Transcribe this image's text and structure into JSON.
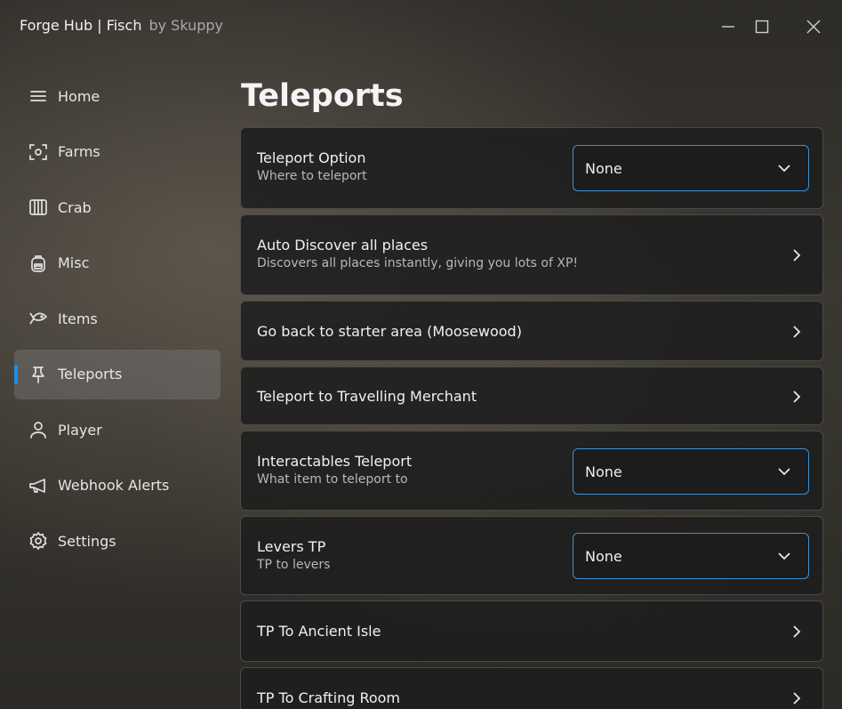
{
  "window": {
    "title": "Forge Hub | Fisch",
    "author": "by Skuppy"
  },
  "sidebar": {
    "items": [
      {
        "label": "Home",
        "icon": "menu-icon"
      },
      {
        "label": "Farms",
        "icon": "scan-icon"
      },
      {
        "label": "Crab",
        "icon": "cage-icon"
      },
      {
        "label": "Misc",
        "icon": "backpack-icon"
      },
      {
        "label": "Items",
        "icon": "fish-icon"
      },
      {
        "label": "Teleports",
        "icon": "pin-icon",
        "active": true
      },
      {
        "label": "Player",
        "icon": "user-icon"
      },
      {
        "label": "Webhook Alerts",
        "icon": "megaphone-icon"
      },
      {
        "label": "Settings",
        "icon": "gear-icon"
      }
    ]
  },
  "main": {
    "title": "Teleports",
    "cards": [
      {
        "title": "Teleport Option",
        "desc": "Where to teleport",
        "dropdown": "None"
      },
      {
        "title": "Auto Discover all places",
        "desc": "Discovers all places instantly, giving you lots of XP!"
      },
      {
        "title": "Go back to starter area (Moosewood)"
      },
      {
        "title": "Teleport to Travelling Merchant"
      },
      {
        "title": "Interactables Teleport",
        "desc": "What item to teleport to",
        "dropdown": "None"
      },
      {
        "title": "Levers TP",
        "desc": "TP to levers",
        "dropdown": "None"
      },
      {
        "title": "TP To Ancient Isle"
      },
      {
        "title": "TP To Crafting Room"
      }
    ]
  },
  "colors": {
    "accent": "#1e8fe6",
    "dropdown_border": "#3b8fd6",
    "card_bg": "#1e1e1e"
  }
}
